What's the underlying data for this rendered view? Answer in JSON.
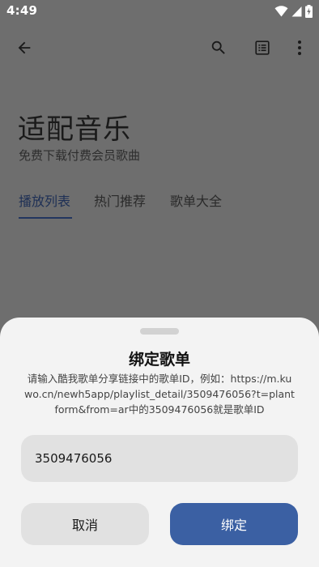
{
  "status_bar": {
    "time": "4:49",
    "icons": [
      "wifi-icon",
      "cellular-signal-icon",
      "battery-charging-icon"
    ]
  },
  "app_bar": {
    "icons": [
      "back-arrow-icon",
      "search-icon",
      "list-icon",
      "more-vert-icon"
    ]
  },
  "header": {
    "title": "适配音乐",
    "subtitle": "免费下载付费会员歌曲"
  },
  "tabs": [
    {
      "label": "播放列表",
      "active": true
    },
    {
      "label": "热门推荐",
      "active": false
    },
    {
      "label": "歌单大全",
      "active": false
    }
  ],
  "dialog": {
    "title": "绑定歌单",
    "description": "请输入酷我歌单分享链接中的歌单ID，例如：https://m.kuwo.cn/newh5app/playlist_detail/3509476056?t=plantform&from=ar中的3509476056就是歌单ID",
    "input_value": "3509476056",
    "cancel_label": "取消",
    "confirm_label": "绑定"
  },
  "colors": {
    "scrim": "#6e6e6e",
    "sheet_background": "#f3f3f3",
    "primary_button": "#3b60a3",
    "secondary_button": "#e1e1e1",
    "active_tab": "#22365f"
  }
}
